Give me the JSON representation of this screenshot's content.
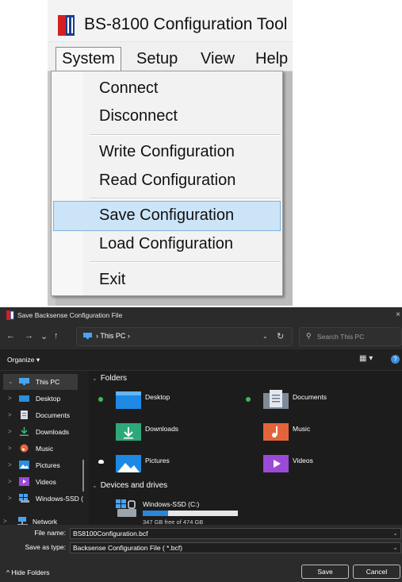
{
  "app": {
    "title": "BS-8100 Configuration Tool",
    "menubar": [
      "System",
      "Setup",
      "View",
      "Help"
    ],
    "system_menu": {
      "items": [
        {
          "label": "Connect"
        },
        {
          "label": "Disconnect"
        },
        {
          "label": "Write Configuration"
        },
        {
          "label": "Read Configuration"
        },
        {
          "label": "Save Configuration",
          "highlighted": true
        },
        {
          "label": "Load Configuration"
        },
        {
          "label": "Exit"
        }
      ]
    }
  },
  "dialog": {
    "title": "Save Backsense Configuration File",
    "close_glyph": "×",
    "nav": {
      "back": "←",
      "forward": "→",
      "recent": "⌄",
      "up": "↑"
    },
    "address": {
      "path": "This PC",
      "separator": "›",
      "refresh": "↻",
      "dropdown": "⌄"
    },
    "search": {
      "placeholder": "Search This PC",
      "icon": "search-icon"
    },
    "toolbar": {
      "organize": "Organize ▾",
      "view": "▦ ▾",
      "help": "?"
    },
    "sidebar": {
      "items": [
        {
          "label": "This PC",
          "chevron": "⌄",
          "icon": "pc-icon",
          "selected": true
        },
        {
          "label": "Desktop",
          "chevron": ">",
          "icon": "desktop-icon"
        },
        {
          "label": "Documents",
          "chevron": ">",
          "icon": "documents-icon"
        },
        {
          "label": "Downloads",
          "chevron": ">",
          "icon": "downloads-icon"
        },
        {
          "label": "Music",
          "chevron": ">",
          "icon": "music-icon"
        },
        {
          "label": "Pictures",
          "chevron": ">",
          "icon": "pictures-icon"
        },
        {
          "label": "Videos",
          "chevron": ">",
          "icon": "videos-icon"
        },
        {
          "label": "Windows-SSD (",
          "chevron": ">",
          "icon": "drive-icon"
        },
        {
          "label": "Network",
          "chevron": ">",
          "icon": "network-icon"
        }
      ]
    },
    "folders_section": {
      "header": "Folders",
      "caret": "⌄",
      "folders": [
        {
          "label": "Desktop",
          "icon": "desktop-folder-icon",
          "synced": true
        },
        {
          "label": "Documents",
          "icon": "documents-folder-icon",
          "synced": true
        },
        {
          "label": "Downloads",
          "icon": "downloads-folder-icon",
          "synced": false
        },
        {
          "label": "Music",
          "icon": "music-folder-icon",
          "synced": false
        },
        {
          "label": "Pictures",
          "icon": "pictures-folder-icon",
          "synced": "cloud"
        },
        {
          "label": "Videos",
          "icon": "videos-folder-icon",
          "synced": false
        }
      ]
    },
    "drives_section": {
      "header": "Devices and drives",
      "caret": "⌄",
      "drives": [
        {
          "label": "Windows-SSD (C:)",
          "free_text": "347 GB free of 474 GB",
          "used_fraction": 0.27
        }
      ]
    },
    "fields": {
      "file_name_label": "File name:",
      "file_name_value": "BS8100Configuration.bcf",
      "save_type_label": "Save as type:",
      "save_type_value": "Backsense Configuration File ( *.bcf)",
      "dropdown_glyph": "⌄"
    },
    "bottom": {
      "hide_folders": "^ Hide Folders",
      "save": "Save",
      "cancel": "Cancel"
    },
    "colors": {
      "accent": "#2a86d9",
      "background": "#202020",
      "panel": "#2b2b2b"
    }
  }
}
